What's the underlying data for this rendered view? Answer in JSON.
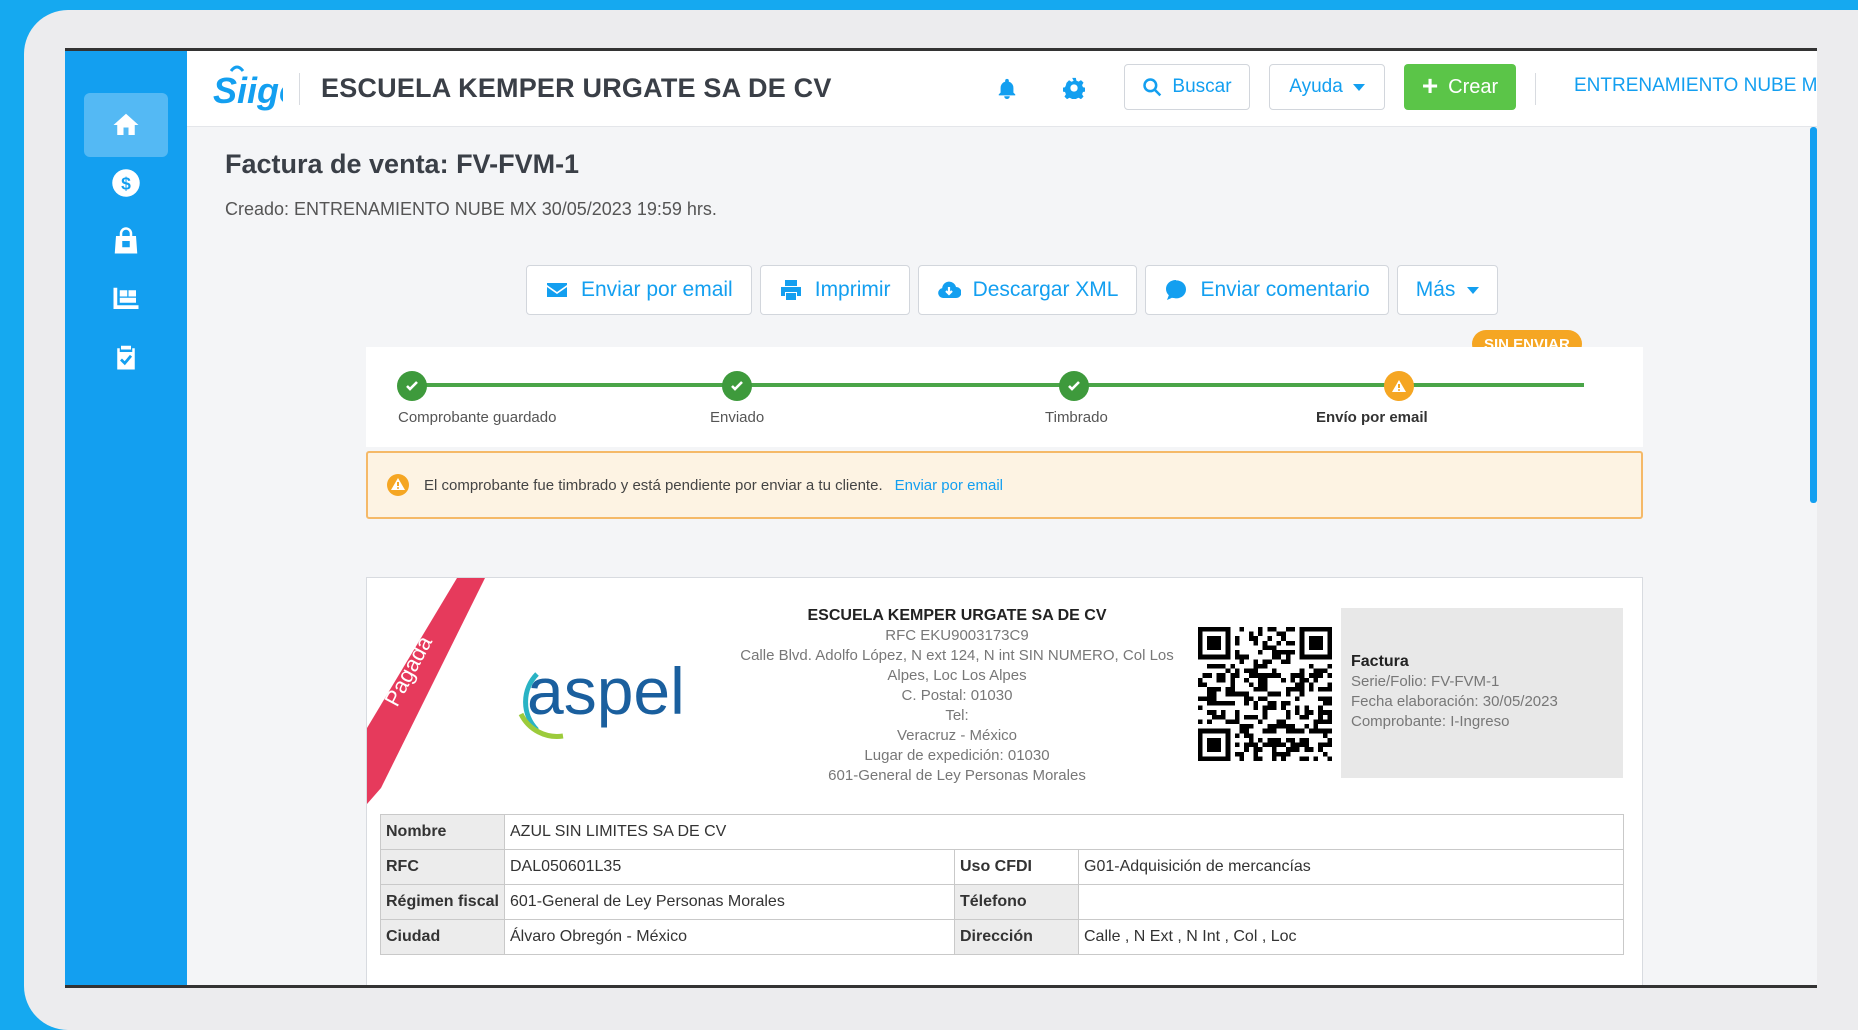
{
  "colors": {
    "brand_blue": "#139ff0",
    "success_green": "#5bc548",
    "warning_orange": "#f5a623"
  },
  "header": {
    "logo_text": "Siigo",
    "company": "ESCUELA KEMPER URGATE SA DE CV",
    "search_label": "Buscar",
    "help_label": "Ayuda",
    "create_label": "Crear",
    "user": "ENTRENAMIENTO NUBE MX"
  },
  "sidebar": {
    "items": [
      {
        "icon": "home-icon",
        "active": true
      },
      {
        "icon": "dollar-icon",
        "active": false
      },
      {
        "icon": "shopping-bag-icon",
        "active": false
      },
      {
        "icon": "inventory-icon",
        "active": false
      },
      {
        "icon": "clipboard-icon",
        "active": false
      }
    ]
  },
  "page": {
    "title": "Factura de venta: FV-FVM-1",
    "created": "Creado: ENTRENAMIENTO NUBE MX 30/05/2023 19:59 hrs."
  },
  "actions": {
    "email": "Enviar por email",
    "print": "Imprimir",
    "download_xml": "Descargar XML",
    "comment": "Enviar comentario",
    "more": "Más"
  },
  "progress": {
    "badge": "SIN ENVIAR",
    "steps": [
      {
        "label": "Comprobante guardado",
        "status": "done"
      },
      {
        "label": "Enviado",
        "status": "done"
      },
      {
        "label": "Timbrado",
        "status": "done"
      },
      {
        "label": "Envío por email",
        "status": "pending"
      }
    ]
  },
  "alert": {
    "message": "El comprobante fue timbrado y está pendiente por enviar a tu cliente.",
    "link": "Enviar por email"
  },
  "invoice": {
    "stamp": "Pagada",
    "logo": "aspel",
    "issuer": {
      "name": "ESCUELA KEMPER URGATE SA DE CV",
      "rfc": "RFC EKU9003173C9",
      "address_1": "Calle Blvd. Adolfo López, N ext 124, N int SIN NUMERO, Col Los",
      "address_2": "Alpes, Loc Los Alpes",
      "postal": "C. Postal: 01030",
      "tel": "Tel:",
      "location": "Veracruz - México",
      "expedition": "Lugar de expedición: 01030",
      "regime": "601-General de Ley Personas Morales"
    },
    "info": {
      "title": "Factura",
      "serie": "Serie/Folio: FV-FVM-1",
      "date": "Fecha elaboración: 30/05/2023",
      "type": "Comprobante: I-Ingreso"
    },
    "client": {
      "name_label": "Nombre",
      "name": "AZUL SIN LIMITES SA DE CV",
      "rfc_label": "RFC",
      "rfc": "DAL050601L35",
      "uso_label": "Uso CFDI",
      "uso": "G01-Adquisición de mercancías",
      "regimen_label": "Régimen fiscal",
      "regimen": "601-General de Ley Personas Morales",
      "tel_label": "Télefono",
      "tel": "",
      "city_label": "Ciudad",
      "city": "Álvaro Obregón - México",
      "address_label": "Dirección",
      "address": "Calle , N Ext , N Int , Col , Loc"
    }
  }
}
